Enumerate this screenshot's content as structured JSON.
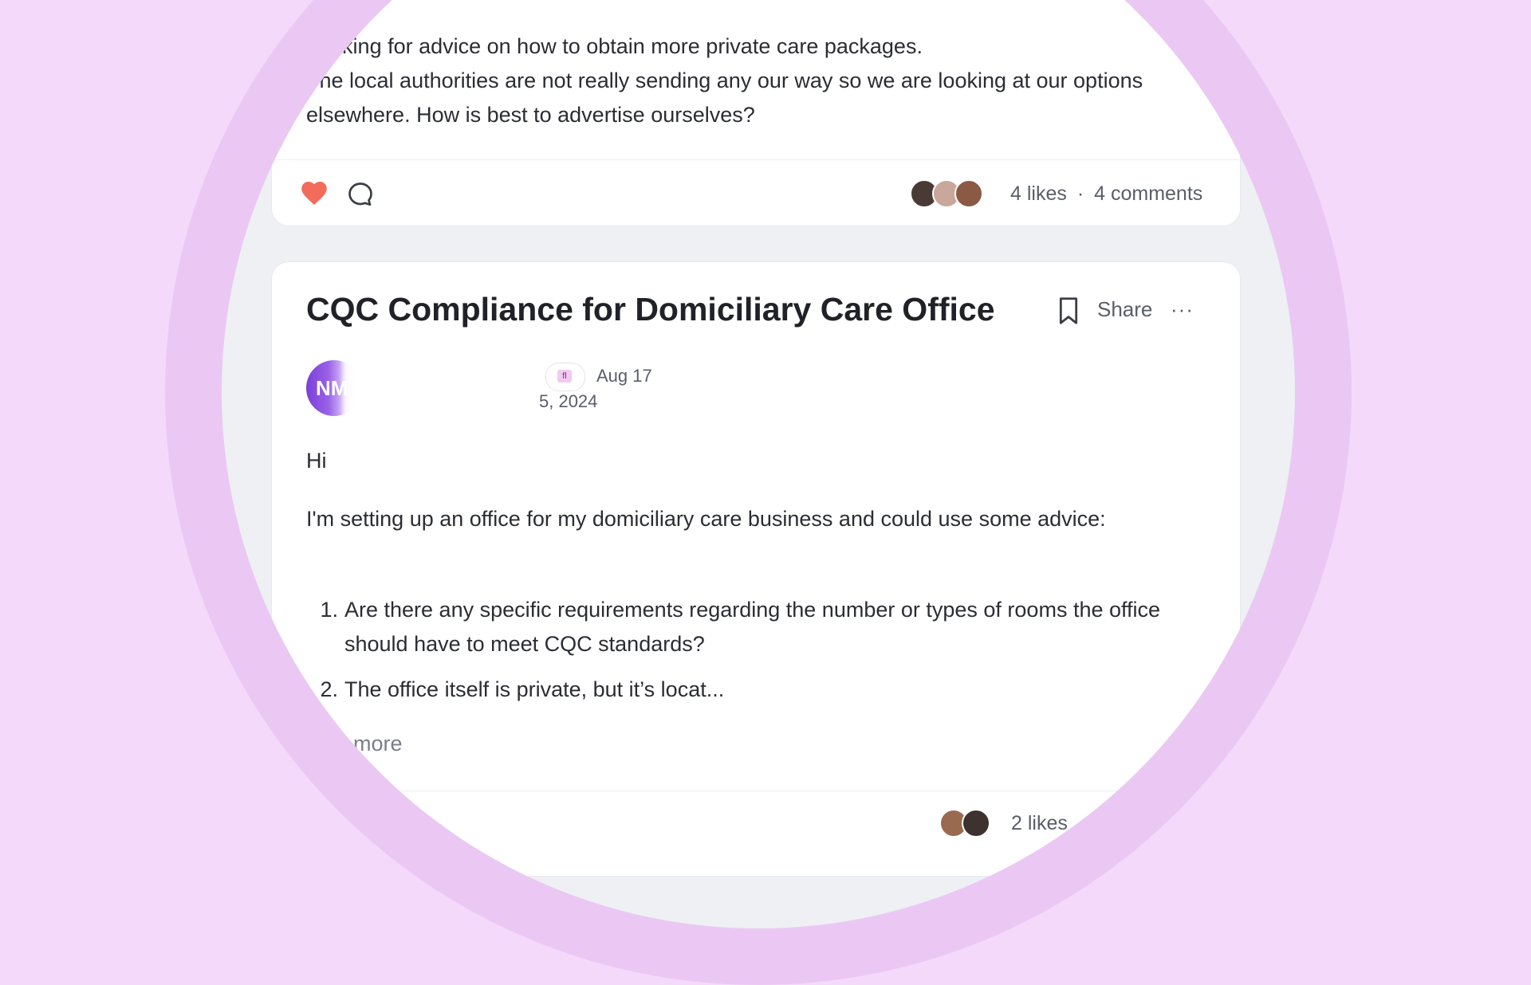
{
  "post_top": {
    "text_lines": [
      "Looking for advice on how to obtain more private care packages.",
      "The local authorities are not really sending any our way so we are looking at our options elsewhere. How is best to advertise ourselves?"
    ],
    "likes": "4 likes",
    "separator": "·",
    "comments": "4 comments"
  },
  "post_main": {
    "title": "CQC Compliance for Domiciliary Care Office",
    "share_label": "Share",
    "more_menu": "···",
    "author_initials": "NM",
    "flag_label": "fl",
    "date_line1": "Aug 17",
    "date_line2": "5, 2024",
    "greeting": "Hi",
    "intro": "I'm setting up an office for my domiciliary care business and could use some advice:",
    "list": [
      {
        "num": "1.",
        "text": "Are there any specific requirements regarding the number or types of rooms the office should have to meet CQC standards?"
      },
      {
        "num": "2.",
        "text": "The office itself is private, but it’s locat..."
      }
    ],
    "read_more": "more",
    "likes": "2 likes",
    "separator": "·"
  },
  "colors": {
    "background": "#f5d9fb",
    "ring": "#ebc8f3",
    "heart": "#f26b5b",
    "avatar_gradient": "#7a3fd8"
  },
  "icons": [
    "heart-icon",
    "comment-icon",
    "bookmark-icon",
    "more-dots-icon"
  ]
}
